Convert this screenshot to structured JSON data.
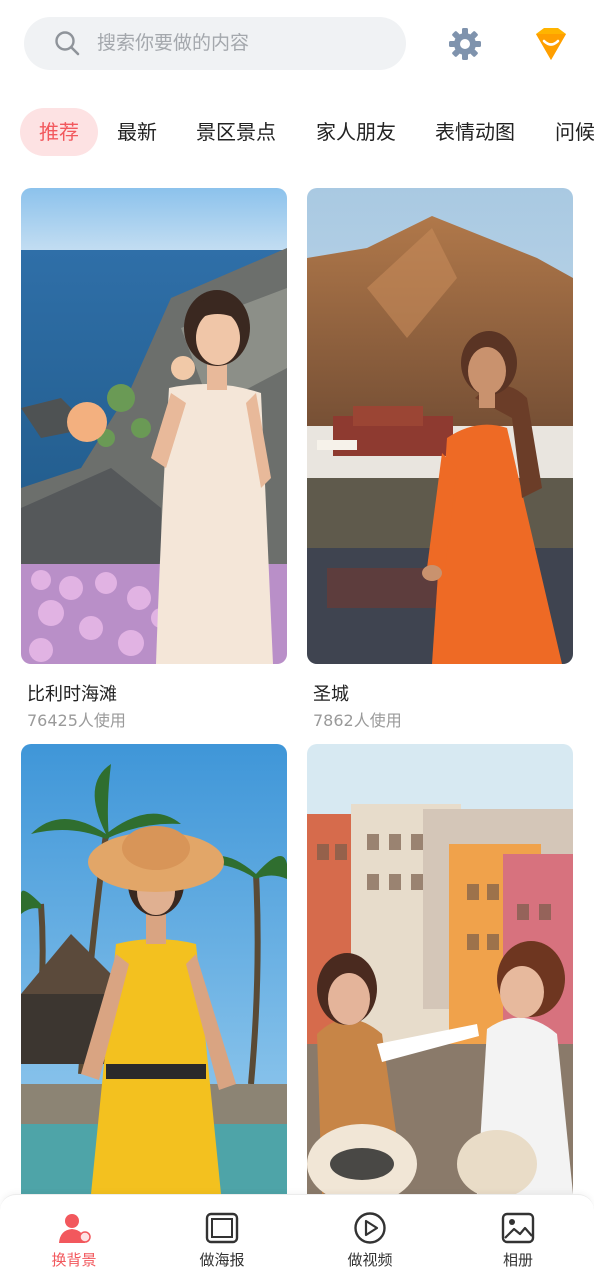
{
  "search": {
    "placeholder": "搜索你要做的内容"
  },
  "header": {
    "icons": [
      "search-icon",
      "gear-icon",
      "vip-crown-icon"
    ]
  },
  "tabs": [
    {
      "label": "推荐",
      "active": true
    },
    {
      "label": "最新",
      "active": false
    },
    {
      "label": "景区景点",
      "active": false
    },
    {
      "label": "家人朋友",
      "active": false
    },
    {
      "label": "表情动图",
      "active": false
    },
    {
      "label": "问候",
      "active": false
    }
  ],
  "cards": [
    {
      "title": "比利时海滩",
      "usage": "76425人使用"
    },
    {
      "title": "圣城",
      "usage": "7862人使用"
    },
    {
      "title": "",
      "usage": ""
    },
    {
      "title": "",
      "usage": ""
    }
  ],
  "bottom_nav": [
    {
      "label": "换背景",
      "icon": "person-swap-icon",
      "active": true
    },
    {
      "label": "做海报",
      "icon": "poster-frame-icon",
      "active": false
    },
    {
      "label": "做视频",
      "icon": "play-circle-icon",
      "active": false
    },
    {
      "label": "相册",
      "icon": "photo-album-icon",
      "active": false
    }
  ],
  "colors": {
    "accent": "#f2585d",
    "tab_active_bg": "#fde2e3",
    "search_bg": "#f0f2f4",
    "vip": "#ffb400",
    "gear": "#7f93ad"
  }
}
